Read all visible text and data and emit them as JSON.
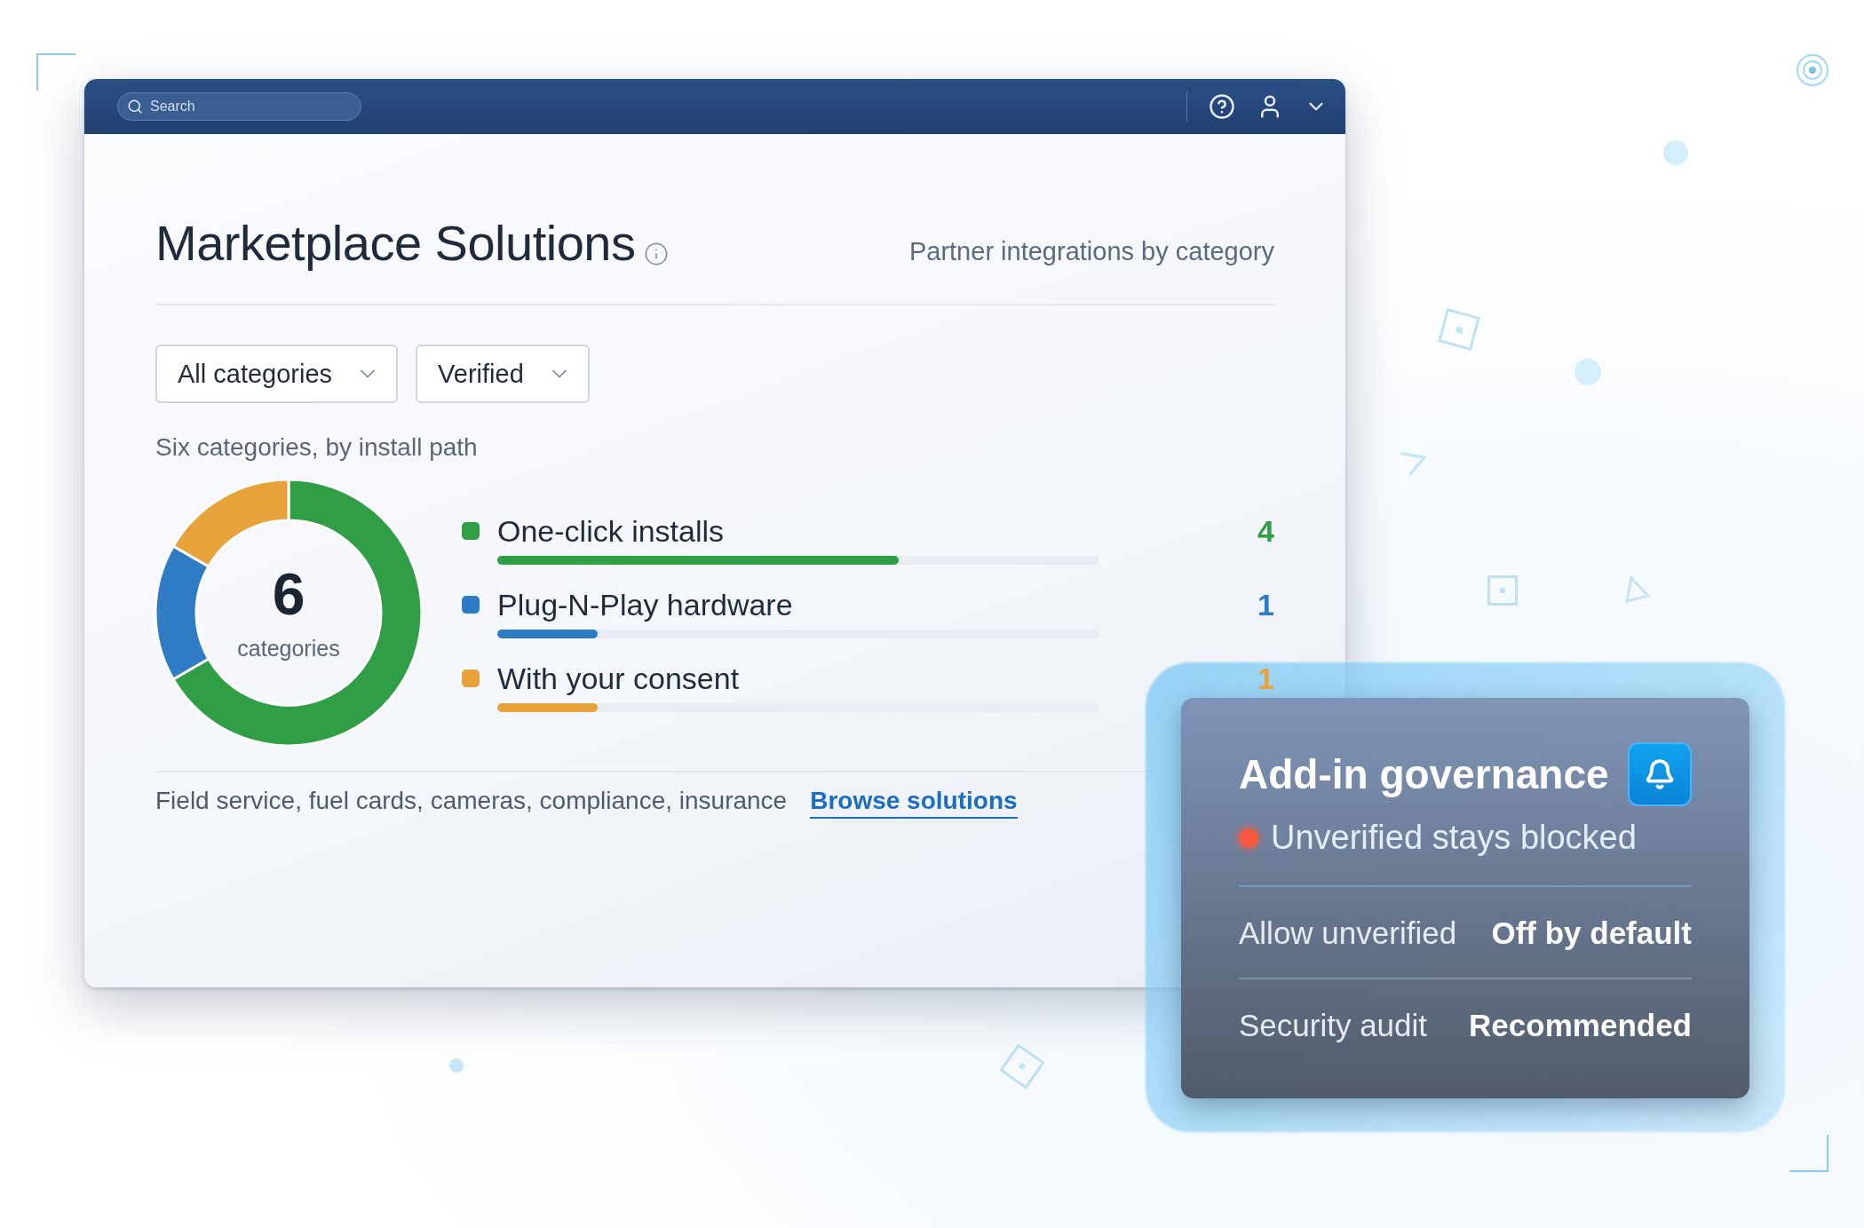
{
  "topbar": {
    "search": {
      "placeholder": "Search"
    }
  },
  "header": {
    "title": "Marketplace Solutions",
    "subtitle": "Partner integrations by category"
  },
  "filters": [
    {
      "label": "All categories"
    },
    {
      "label": "Verified"
    }
  ],
  "section_title": "Six categories, by install path",
  "donut": {
    "center_value": "6",
    "center_label": "categories",
    "chart_data": {
      "type": "donut",
      "categories": [
        "One-click installs",
        "Plug-N-Play hardware",
        "With your consent"
      ],
      "values": [
        66.67,
        16.67,
        16.66
      ]
    }
  },
  "legend": [
    {
      "value": "4",
      "color": "#2f9e44",
      "level": 0.667
    },
    {
      "value": "1",
      "color": "#2f7cc4",
      "level": 0.167
    },
    {
      "value": "1",
      "color": "#e8a23a",
      "level": 0.167
    }
  ],
  "footer": {
    "text": "Field service, fuel cards, cameras, compliance, insurance",
    "link": "Browse solutions"
  },
  "card": {
    "title": "Add-in governance",
    "status": "Unverified stays blocked",
    "rows": [
      {
        "label": "Allow unverified",
        "value": "Off by default"
      },
      {
        "label": "Security audit",
        "value": "Recommended"
      }
    ]
  }
}
